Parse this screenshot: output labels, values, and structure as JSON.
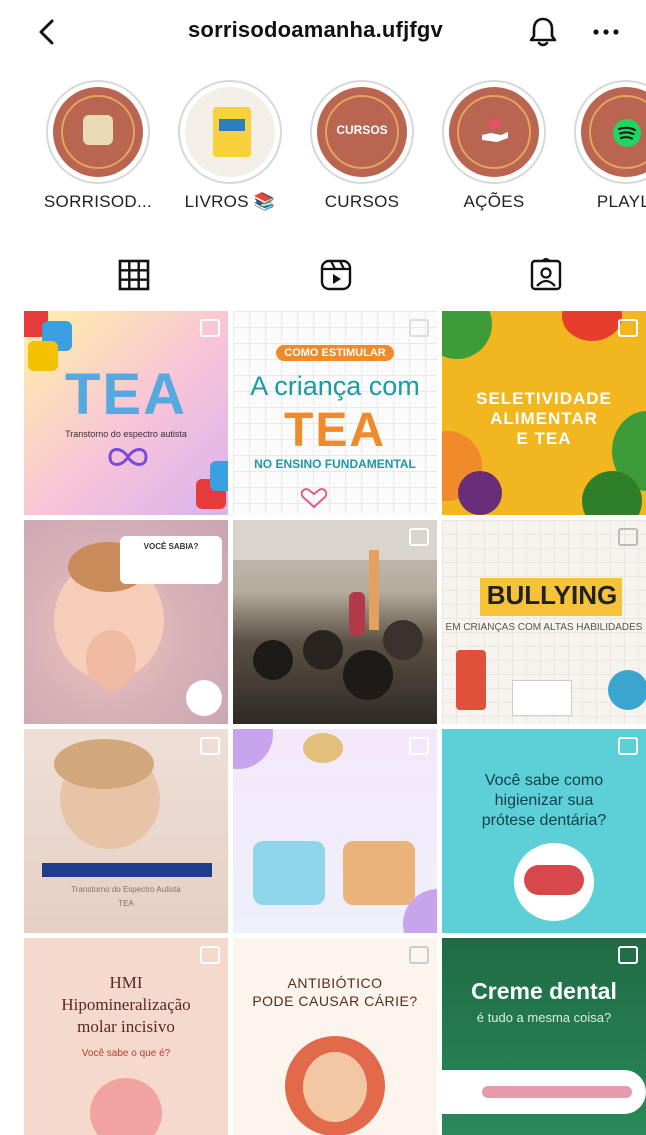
{
  "header": {
    "username": "sorrisodoamanha.ufjfgv"
  },
  "highlights": [
    {
      "label": "SORRISOD...",
      "cover_text": ""
    },
    {
      "label": "LIVROS 📚",
      "cover_text": ""
    },
    {
      "label": "CURSOS",
      "cover_text": "CURSOS"
    },
    {
      "label": "AÇÕES",
      "cover_text": ""
    },
    {
      "label": "PLAYLI",
      "cover_text": ""
    }
  ],
  "tabs": [
    {
      "name": "grid",
      "icon": "grid-icon",
      "active": true
    },
    {
      "name": "reels",
      "icon": "reels-icon",
      "active": false
    },
    {
      "name": "tagged",
      "icon": "tagged-icon",
      "active": false
    }
  ],
  "posts": {
    "p1": {
      "title": "TEA",
      "subtitle": "Transtorno do espectro autista"
    },
    "p2": {
      "kicker": "COMO ESTIMULAR",
      "line1": "A criança com",
      "line2": "TEA",
      "line3": "NO ENSINO FUNDAMENTAL"
    },
    "p3": {
      "line1": "SELETIVIDADE",
      "line2": "ALIMENTAR",
      "line3": "E TEA"
    },
    "p4": {
      "box": "VOCÊ SABIA?"
    },
    "p6": {
      "line1": "BULLYING",
      "line2": "EM CRIANÇAS COM ALTAS HABILIDADES"
    },
    "p7": {
      "line2": "Transtorno do Espectro Autista",
      "line3": "TEA"
    },
    "p9": {
      "line1": "Você sabe como higienizar sua prótese dentária?"
    },
    "p10": {
      "line1": "HMI",
      "line2": "Hipomineralização",
      "line3": "molar incisivo",
      "line4": "Você sabe o que é?"
    },
    "p11": {
      "line1": "ANTIBIÓTICO",
      "line2": "PODE CAUSAR CÁRIE?"
    },
    "p12": {
      "line1": "Creme dental",
      "line2": "é tudo a mesma coisa?"
    }
  },
  "colors": {
    "highlight_bg": "#b96552",
    "highlight_ring": "#e5a45c",
    "text": "#111111"
  }
}
